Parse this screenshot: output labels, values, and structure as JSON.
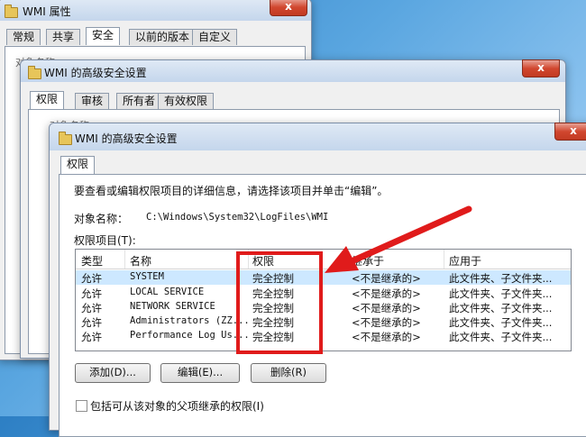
{
  "win1": {
    "title": "WMI 属性",
    "tabs": [
      "常规",
      "共享",
      "安全",
      "以前的版本",
      "自定义"
    ],
    "active_tab": 2,
    "object_label": "对象名称",
    "close": "x"
  },
  "win2": {
    "title": "WMI 的高级安全设置",
    "tabs": [
      "权限",
      "审核",
      "所有者",
      "有效权限"
    ],
    "object_label": "对象名称",
    "close": "x"
  },
  "win3": {
    "title": "WMI 的高级安全设置",
    "tab": "权限",
    "description": "要查看或编辑权限项目的详细信息，请选择该项目并单击“编辑”。",
    "object_name_label": "对象名称：",
    "object_name_value": "C:\\Windows\\System32\\LogFiles\\WMI",
    "entries_label": "权限项目(T):",
    "columns": [
      "类型",
      "名称",
      "权限",
      "继承于",
      "应用于"
    ],
    "rows": [
      {
        "type": "允许",
        "name": "SYSTEM",
        "perm": "完全控制",
        "inherit": "<不是继承的>",
        "apply": "此文件夹、子文件夹..."
      },
      {
        "type": "允许",
        "name": "LOCAL SERVICE",
        "perm": "完全控制",
        "inherit": "<不是继承的>",
        "apply": "此文件夹、子文件夹..."
      },
      {
        "type": "允许",
        "name": "NETWORK SERVICE",
        "perm": "完全控制",
        "inherit": "<不是继承的>",
        "apply": "此文件夹、子文件夹..."
      },
      {
        "type": "允许",
        "name": "Administrators (ZZ...",
        "perm": "完全控制",
        "inherit": "<不是继承的>",
        "apply": "此文件夹、子文件夹..."
      },
      {
        "type": "允许",
        "name": "Performance Log Us...",
        "perm": "完全控制",
        "inherit": "<不是继承的>",
        "apply": "此文件夹、子文件夹..."
      }
    ],
    "buttons": {
      "add": "添加(D)...",
      "edit": "编辑(E)...",
      "remove": "删除(R)"
    },
    "inherit_checkbox": "包括可从该对象的父项继承的权限(I)",
    "close": "x"
  },
  "colors": {
    "highlight": "#e01b1b",
    "selection": "#cde8ff"
  }
}
